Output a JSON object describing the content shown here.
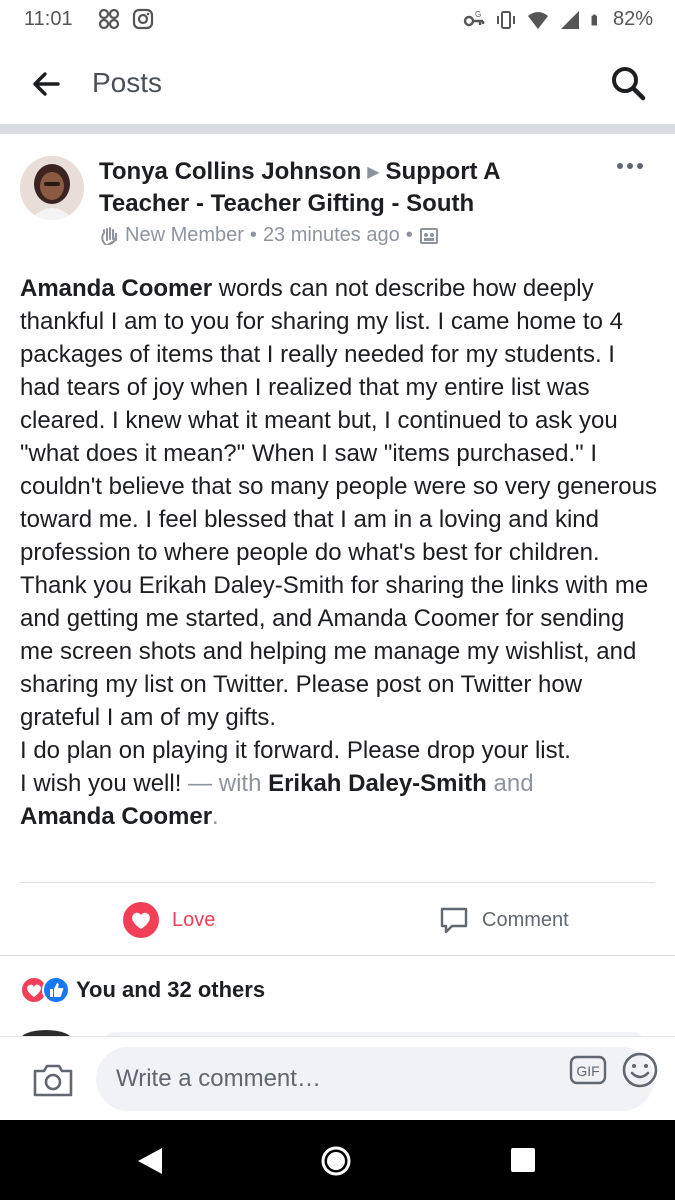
{
  "status": {
    "time": "11:01",
    "battery": "82%",
    "icons_left": [
      "pinwheel-icon",
      "instagram-icon"
    ],
    "icons_right": [
      "key-icon",
      "vibrate-icon",
      "wifi-icon",
      "signal-icon",
      "battery-icon"
    ]
  },
  "header": {
    "title": "Posts"
  },
  "post": {
    "author": "Tonya Collins Johnson",
    "group": "Support A Teacher - Teacher Gifting - South",
    "badge": "New Member",
    "time": "23 minutes ago",
    "body": {
      "mention_1": "Amanda Coomer",
      "para_1": " words can not describe how deeply thankful I am to you for sharing my list.  I came home to 4 packages of items that I really needed for my students.  I  had tears of joy when I realized that my entire list was cleared.  I knew what it meant but, I continued to ask you \"what does it mean?\" When I saw \"items purchased.\" I couldn't believe that so many people were so very generous toward me.  I feel blessed that I am in a loving and kind profession to where people do what's best for children.",
      "para_2": "Thank you Erikah Daley-Smith for sharing the links with me and getting me started, and Amanda Coomer for sending me screen shots and helping me manage my wishlist, and sharing my list on Twitter.  Please post on Twitter how grateful I am of my gifts.",
      "para_3": "I do plan on playing it forward.  Please drop your list.",
      "para_4_start": "I wish you well! ",
      "with_text": "— with ",
      "tag_1": "Erikah Daley-Smith",
      "and_text": " and",
      "tag_2": "Amanda Coomer",
      "period": "."
    },
    "actions": {
      "love": "Love",
      "comment": "Comment"
    },
    "reactions": {
      "summary": "You and 32 others"
    }
  },
  "composer": {
    "placeholder": "Write a comment…",
    "gif": "GIF"
  },
  "colors": {
    "love": "#f33e58",
    "like": "#1877f2",
    "muted": "#8d949e",
    "divider": "#d9dbdf"
  }
}
